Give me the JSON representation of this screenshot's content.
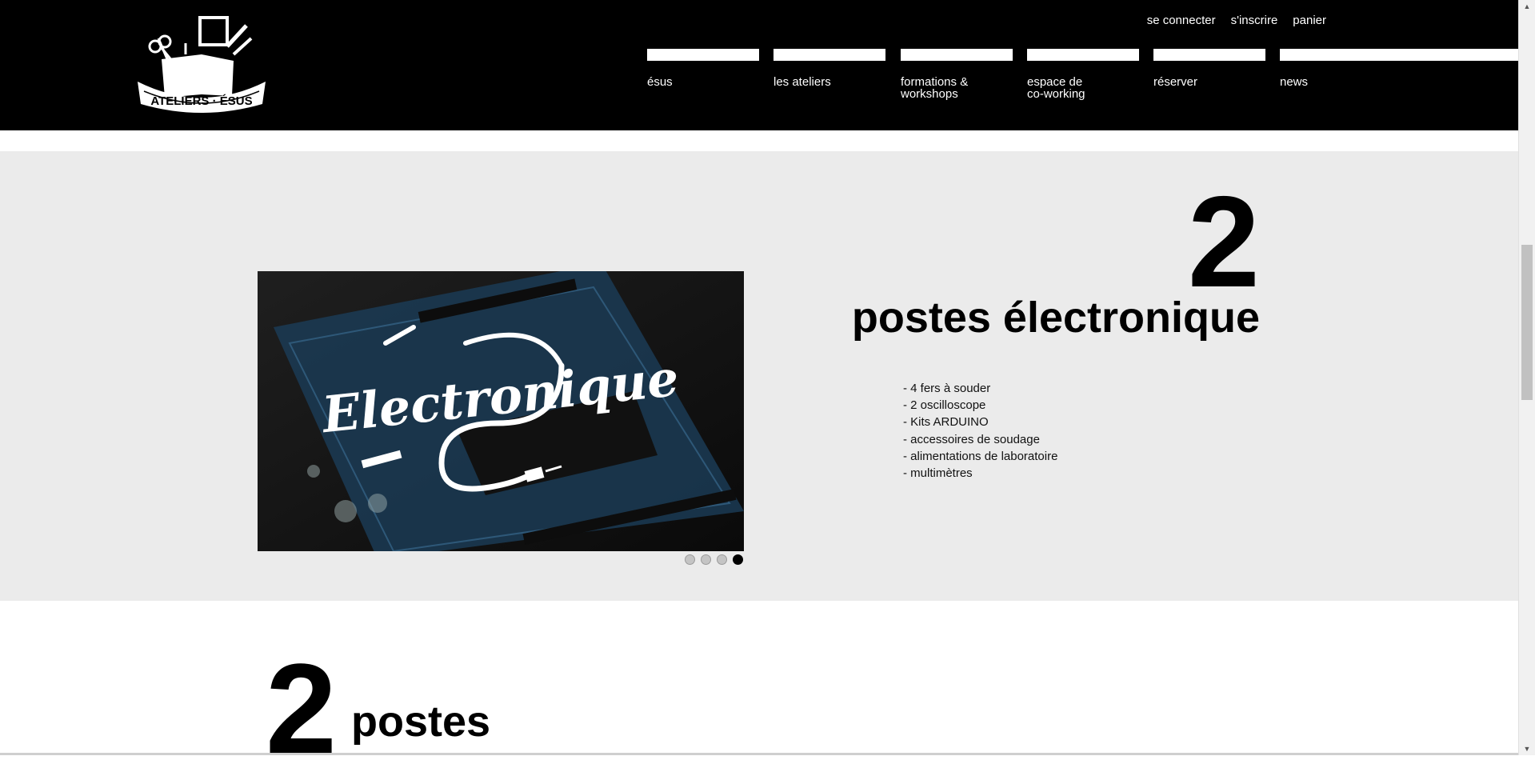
{
  "header": {
    "logo_text": "ATELIERS · ÉSUS",
    "account_links": [
      "se connecter",
      "s'inscrire",
      "panier"
    ],
    "nav": [
      {
        "label": "ésus"
      },
      {
        "label": "les ateliers"
      },
      {
        "label": "formations &\nworkshops"
      },
      {
        "label": "espace de\nco-working"
      },
      {
        "label": "réserver"
      },
      {
        "label": "news"
      }
    ]
  },
  "section": {
    "count": "2",
    "title": "postes électronique",
    "items": [
      "- 4 fers à souder",
      "- 2 oscilloscope",
      "- Kits ARDUINO",
      "- accessoires de soudage",
      "- alimentations de laboratoire",
      "- multimètres"
    ],
    "slider": {
      "image_title": "Electronique",
      "slide_count": 4,
      "active_slide": 4
    }
  },
  "next_section": {
    "count": "2",
    "title": "postes"
  },
  "colors": {
    "header_bg": "#000000",
    "section_bg": "#ebebeb",
    "text": "#000000"
  },
  "icons": [
    "toolbox-logo-icon",
    "scroll-up-arrow-icon",
    "scroll-down-arrow-icon"
  ]
}
